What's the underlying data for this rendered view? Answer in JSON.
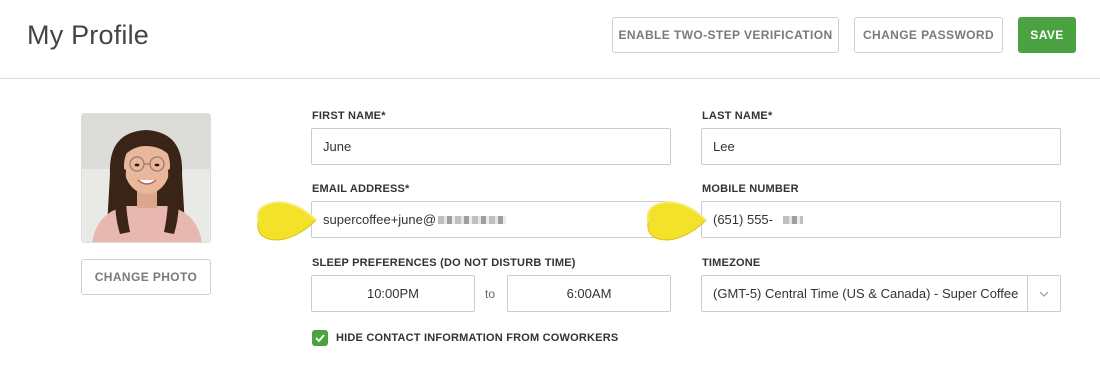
{
  "header": {
    "title": "My Profile",
    "two_step_label": "ENABLE TWO-STEP VERIFICATION",
    "change_password_label": "CHANGE PASSWORD",
    "save_label": "SAVE"
  },
  "profile": {
    "change_photo_label": "CHANGE PHOTO"
  },
  "form": {
    "first_name": {
      "label": "FIRST NAME*",
      "value": "June"
    },
    "last_name": {
      "label": "LAST NAME*",
      "value": "Lee"
    },
    "email": {
      "label": "EMAIL ADDRESS*",
      "value": "supercoffee+june@"
    },
    "mobile": {
      "label": "MOBILE NUMBER",
      "value": "(651) 555-"
    },
    "sleep": {
      "label": "SLEEP PREFERENCES (DO NOT DISTURB TIME)",
      "start": "10:00PM",
      "to": "to",
      "end": "6:00AM"
    },
    "timezone": {
      "label": "TIMEZONE",
      "value": "(GMT-5) Central Time (US & Canada) - Super Coffee"
    },
    "hide_contact": {
      "label": "HIDE CONTACT INFORMATION FROM COWORKERS",
      "checked": true
    }
  },
  "colors": {
    "accent": "#4aa340",
    "pointer": "#f3e12a"
  },
  "icons": [
    "check-icon",
    "chevron-down-icon",
    "pointer-arrow-icon"
  ]
}
